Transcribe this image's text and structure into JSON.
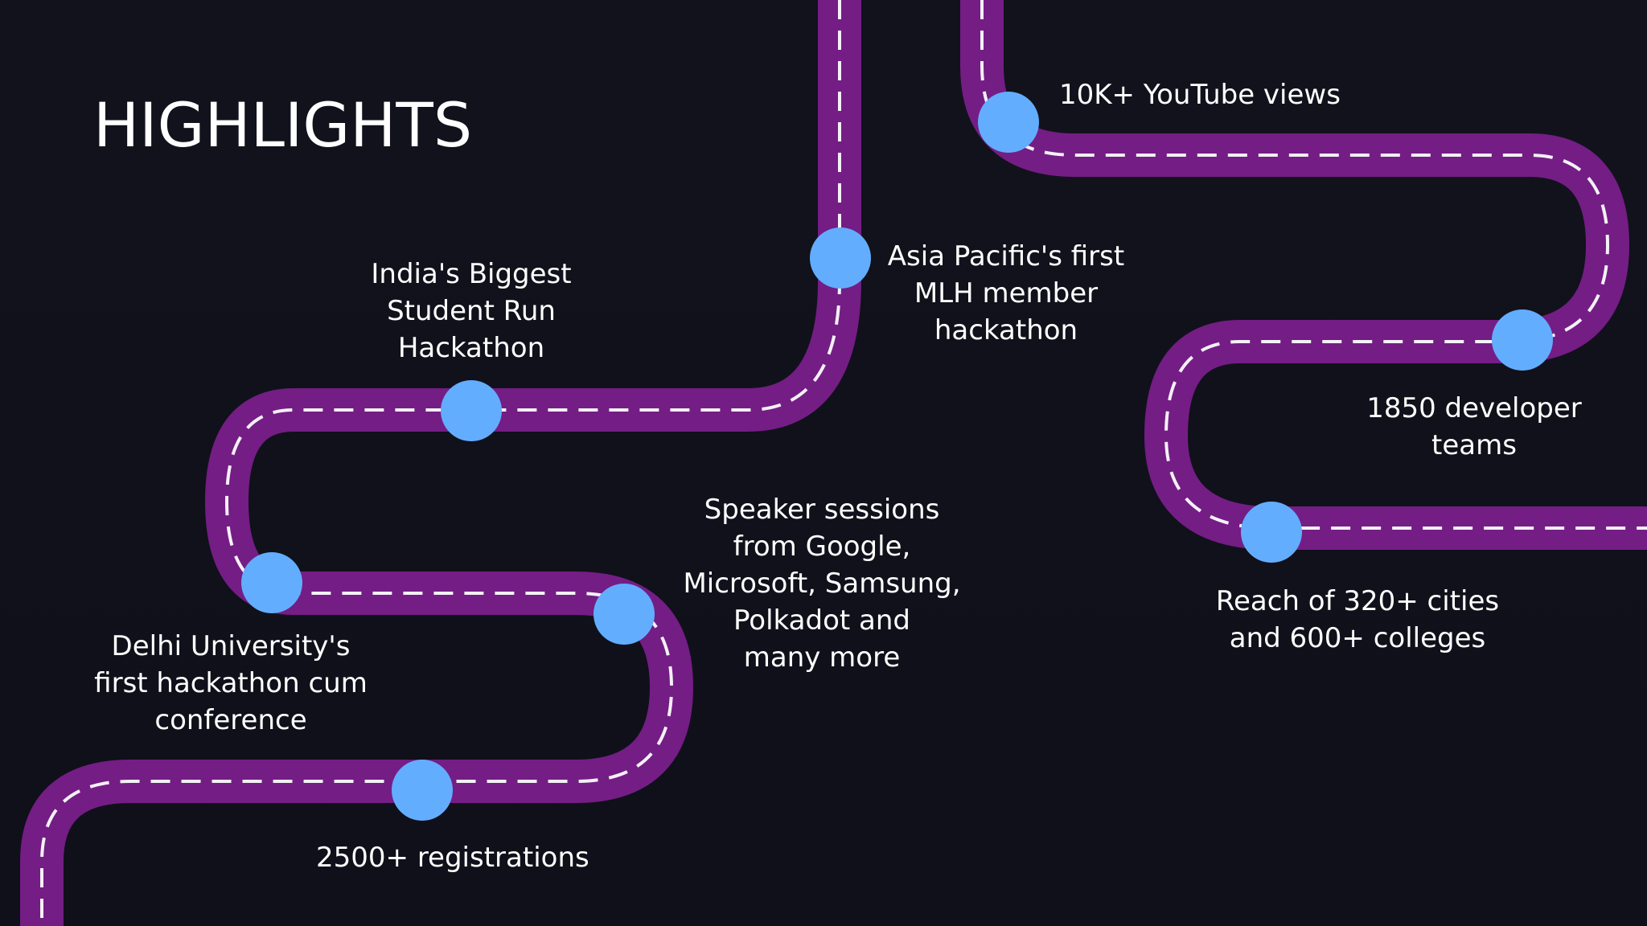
{
  "slide": {
    "title": "HIGHLIGHTS",
    "colors": {
      "background": "#11111b",
      "road": "#741d85",
      "lane_marking": "#f4f1f6",
      "milestone": "#63adff",
      "text": "#ffffff"
    },
    "milestones": [
      {
        "id": "biggest",
        "text": "India's Biggest\nStudent Run\nHackathon"
      },
      {
        "id": "asia",
        "text": "Asia Pacific's first\nMLH member\nhackathon"
      },
      {
        "id": "youtube",
        "text": "10K+ YouTube views"
      },
      {
        "id": "teams",
        "text": "1850 developer\nteams"
      },
      {
        "id": "reach",
        "text": "Reach of 320+ cities\nand 600+ colleges"
      },
      {
        "id": "speakers",
        "text": "Speaker sessions\nfrom Google,\nMicrosoft, Samsung,\nPolkadot and\nmany more"
      },
      {
        "id": "delhi",
        "text": "Delhi University's\nfirst hackathon cum\nconference"
      },
      {
        "id": "registrations",
        "text": "2500+ registrations"
      }
    ]
  }
}
